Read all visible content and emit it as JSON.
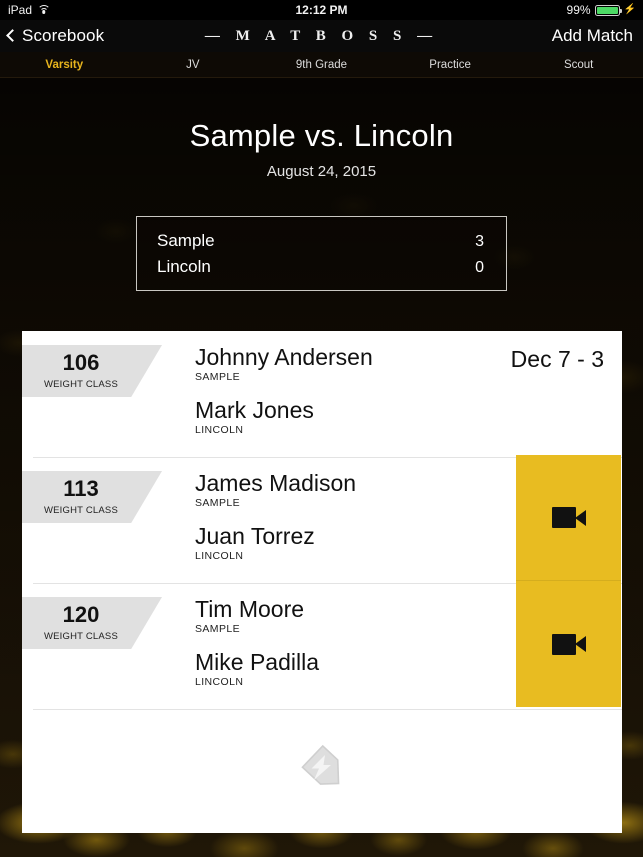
{
  "statusbar": {
    "device": "iPad",
    "wifi_icon": "wifi-icon",
    "time": "12:12 PM",
    "battery_percent": "99%",
    "battery_icon": "battery-icon",
    "charging_icon": "lightning-bolt-icon",
    "battery_color": "#4cd964"
  },
  "navbar": {
    "back_icon": "chevron-left-icon",
    "back_label": "Scorebook",
    "brand": "— M A T B O S S —",
    "add_match_label": "Add Match"
  },
  "tabs": {
    "active_index": 0,
    "active_color": "#e8b51d",
    "items": [
      {
        "label": "Varsity"
      },
      {
        "label": "JV"
      },
      {
        "label": "9th Grade"
      },
      {
        "label": "Practice"
      },
      {
        "label": "Scout"
      }
    ]
  },
  "match": {
    "title": "Sample vs. Lincoln",
    "date": "August 24, 2015",
    "score": [
      {
        "team": "Sample",
        "points": "3"
      },
      {
        "team": "Lincoln",
        "points": "0"
      }
    ]
  },
  "bouts": {
    "weight_class_label": "WEIGHT CLASS",
    "video_icon": "video-camera-icon",
    "video_panel_color": "#e8bc21",
    "rows": [
      {
        "weight": "106",
        "wrestler1": {
          "name": "Johnny Andersen",
          "team": "SAMPLE"
        },
        "wrestler2": {
          "name": "Mark Jones",
          "team": "LINCOLN"
        },
        "result": "Dec 7 - 3",
        "has_video": false
      },
      {
        "weight": "113",
        "wrestler1": {
          "name": "James Madison",
          "team": "SAMPLE"
        },
        "wrestler2": {
          "name": "Juan Torrez",
          "team": "LINCOLN"
        },
        "result": "",
        "has_video": true
      },
      {
        "weight": "120",
        "wrestler1": {
          "name": "Tim Moore",
          "team": "SAMPLE"
        },
        "wrestler2": {
          "name": "Mike Padilla",
          "team": "LINCOLN"
        },
        "result": "",
        "has_video": true
      }
    ]
  },
  "watermark": {
    "icon": "matboss-logo-watermark",
    "color": "#dcdcdc"
  }
}
